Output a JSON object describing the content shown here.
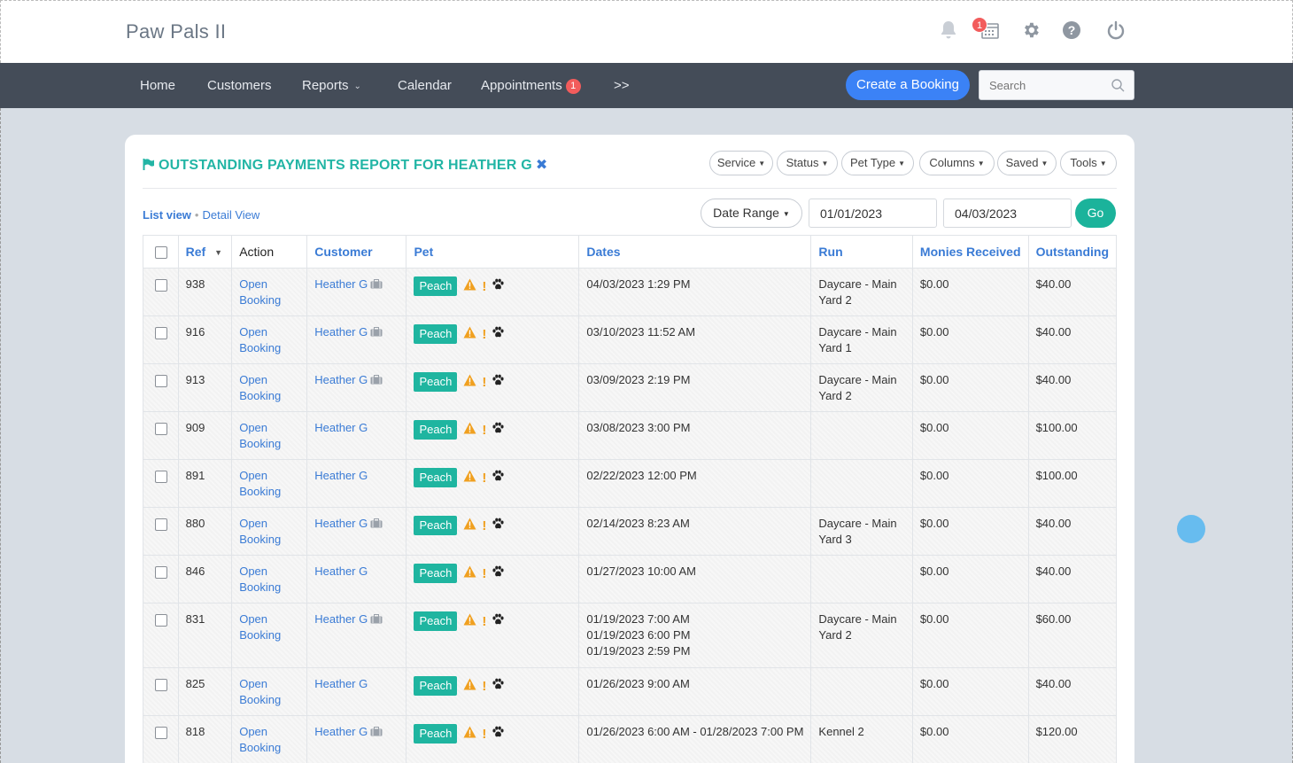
{
  "app": {
    "title": "Paw Pals II",
    "calendar_badge": "1"
  },
  "top_icons": [
    "bell-icon",
    "calendar-icon",
    "gear-icon",
    "help-icon",
    "power-icon"
  ],
  "nav": {
    "items": [
      "Home",
      "Customers",
      "Reports",
      "Calendar",
      "Appointments",
      ">>"
    ],
    "appointments_badge": "1",
    "create_button": "Create a Booking",
    "search_placeholder": "Search"
  },
  "report": {
    "title": "OUTSTANDING PAYMENTS REPORT FOR HEATHER G",
    "close_glyph": "✖",
    "filters": [
      "Service",
      "Status",
      "Pet Type",
      "Columns",
      "Saved",
      "Tools"
    ],
    "list_view": "List view",
    "dot": "•",
    "detail_view": "Detail View",
    "date_range_label": "Date Range",
    "date_from": "01/01/2023",
    "date_to": "04/03/2023",
    "go_label": "Go",
    "columns": [
      "Ref",
      "Action",
      "Customer",
      "Pet",
      "Dates",
      "Run",
      "Monies Received",
      "Outstanding"
    ],
    "rows": [
      {
        "ref": "938",
        "action1": "Open",
        "action2": "Booking",
        "customer": "Heather G",
        "case": true,
        "pet": "Peach",
        "dates": [
          "04/03/2023 1:29 PM"
        ],
        "run": "Daycare - Main Yard 2",
        "received": "$0.00",
        "outstanding": "$40.00"
      },
      {
        "ref": "916",
        "action1": "Open",
        "action2": "Booking",
        "customer": "Heather G",
        "case": true,
        "pet": "Peach",
        "dates": [
          "03/10/2023 11:52 AM"
        ],
        "run": "Daycare - Main Yard 1",
        "received": "$0.00",
        "outstanding": "$40.00"
      },
      {
        "ref": "913",
        "action1": "Open",
        "action2": "Booking",
        "customer": "Heather G",
        "case": true,
        "pet": "Peach",
        "dates": [
          "03/09/2023 2:19 PM"
        ],
        "run": "Daycare - Main Yard 2",
        "received": "$0.00",
        "outstanding": "$40.00"
      },
      {
        "ref": "909",
        "action1": "Open",
        "action2": "Booking",
        "customer": "Heather G",
        "case": false,
        "pet": "Peach",
        "dates": [
          "03/08/2023 3:00 PM"
        ],
        "run": "",
        "received": "$0.00",
        "outstanding": "$100.00"
      },
      {
        "ref": "891",
        "action1": "Open",
        "action2": "Booking",
        "customer": "Heather G",
        "case": false,
        "pet": "Peach",
        "dates": [
          "02/22/2023 12:00 PM"
        ],
        "run": "",
        "received": "$0.00",
        "outstanding": "$100.00"
      },
      {
        "ref": "880",
        "action1": "Open",
        "action2": "Booking",
        "customer": "Heather G",
        "case": true,
        "pet": "Peach",
        "dates": [
          "02/14/2023 8:23 AM"
        ],
        "run": "Daycare - Main Yard 3",
        "received": "$0.00",
        "outstanding": "$40.00"
      },
      {
        "ref": "846",
        "action1": "Open",
        "action2": "Booking",
        "customer": "Heather G",
        "case": false,
        "pet": "Peach",
        "dates": [
          "01/27/2023 10:00 AM"
        ],
        "run": "",
        "received": "$0.00",
        "outstanding": "$40.00"
      },
      {
        "ref": "831",
        "action1": "Open",
        "action2": "Booking",
        "customer": "Heather G",
        "case": true,
        "pet": "Peach",
        "dates": [
          "01/19/2023 7:00 AM",
          "01/19/2023 6:00 PM",
          "01/19/2023 2:59 PM"
        ],
        "run": "Daycare - Main Yard 2",
        "received": "$0.00",
        "outstanding": "$60.00"
      },
      {
        "ref": "825",
        "action1": "Open",
        "action2": "Booking",
        "customer": "Heather G",
        "case": false,
        "pet": "Peach",
        "dates": [
          "01/26/2023 9:00 AM"
        ],
        "run": "",
        "received": "$0.00",
        "outstanding": "$40.00"
      },
      {
        "ref": "818",
        "action1": "Open",
        "action2": "Booking",
        "customer": "Heather G",
        "case": true,
        "pet": "Peach",
        "dates": [
          "01/26/2023 6:00 AM - 01/28/2023 7:00 PM"
        ],
        "run": "Kennel 2",
        "received": "$0.00",
        "outstanding": "$120.00"
      }
    ]
  },
  "colors": {
    "accent_teal": "#1fb5a0",
    "link_blue": "#3a7bd5",
    "nav_bg": "#444c58",
    "create_blue": "#3b82f6",
    "badge_red": "#f25c5c",
    "warning_orange": "#f0a020"
  }
}
